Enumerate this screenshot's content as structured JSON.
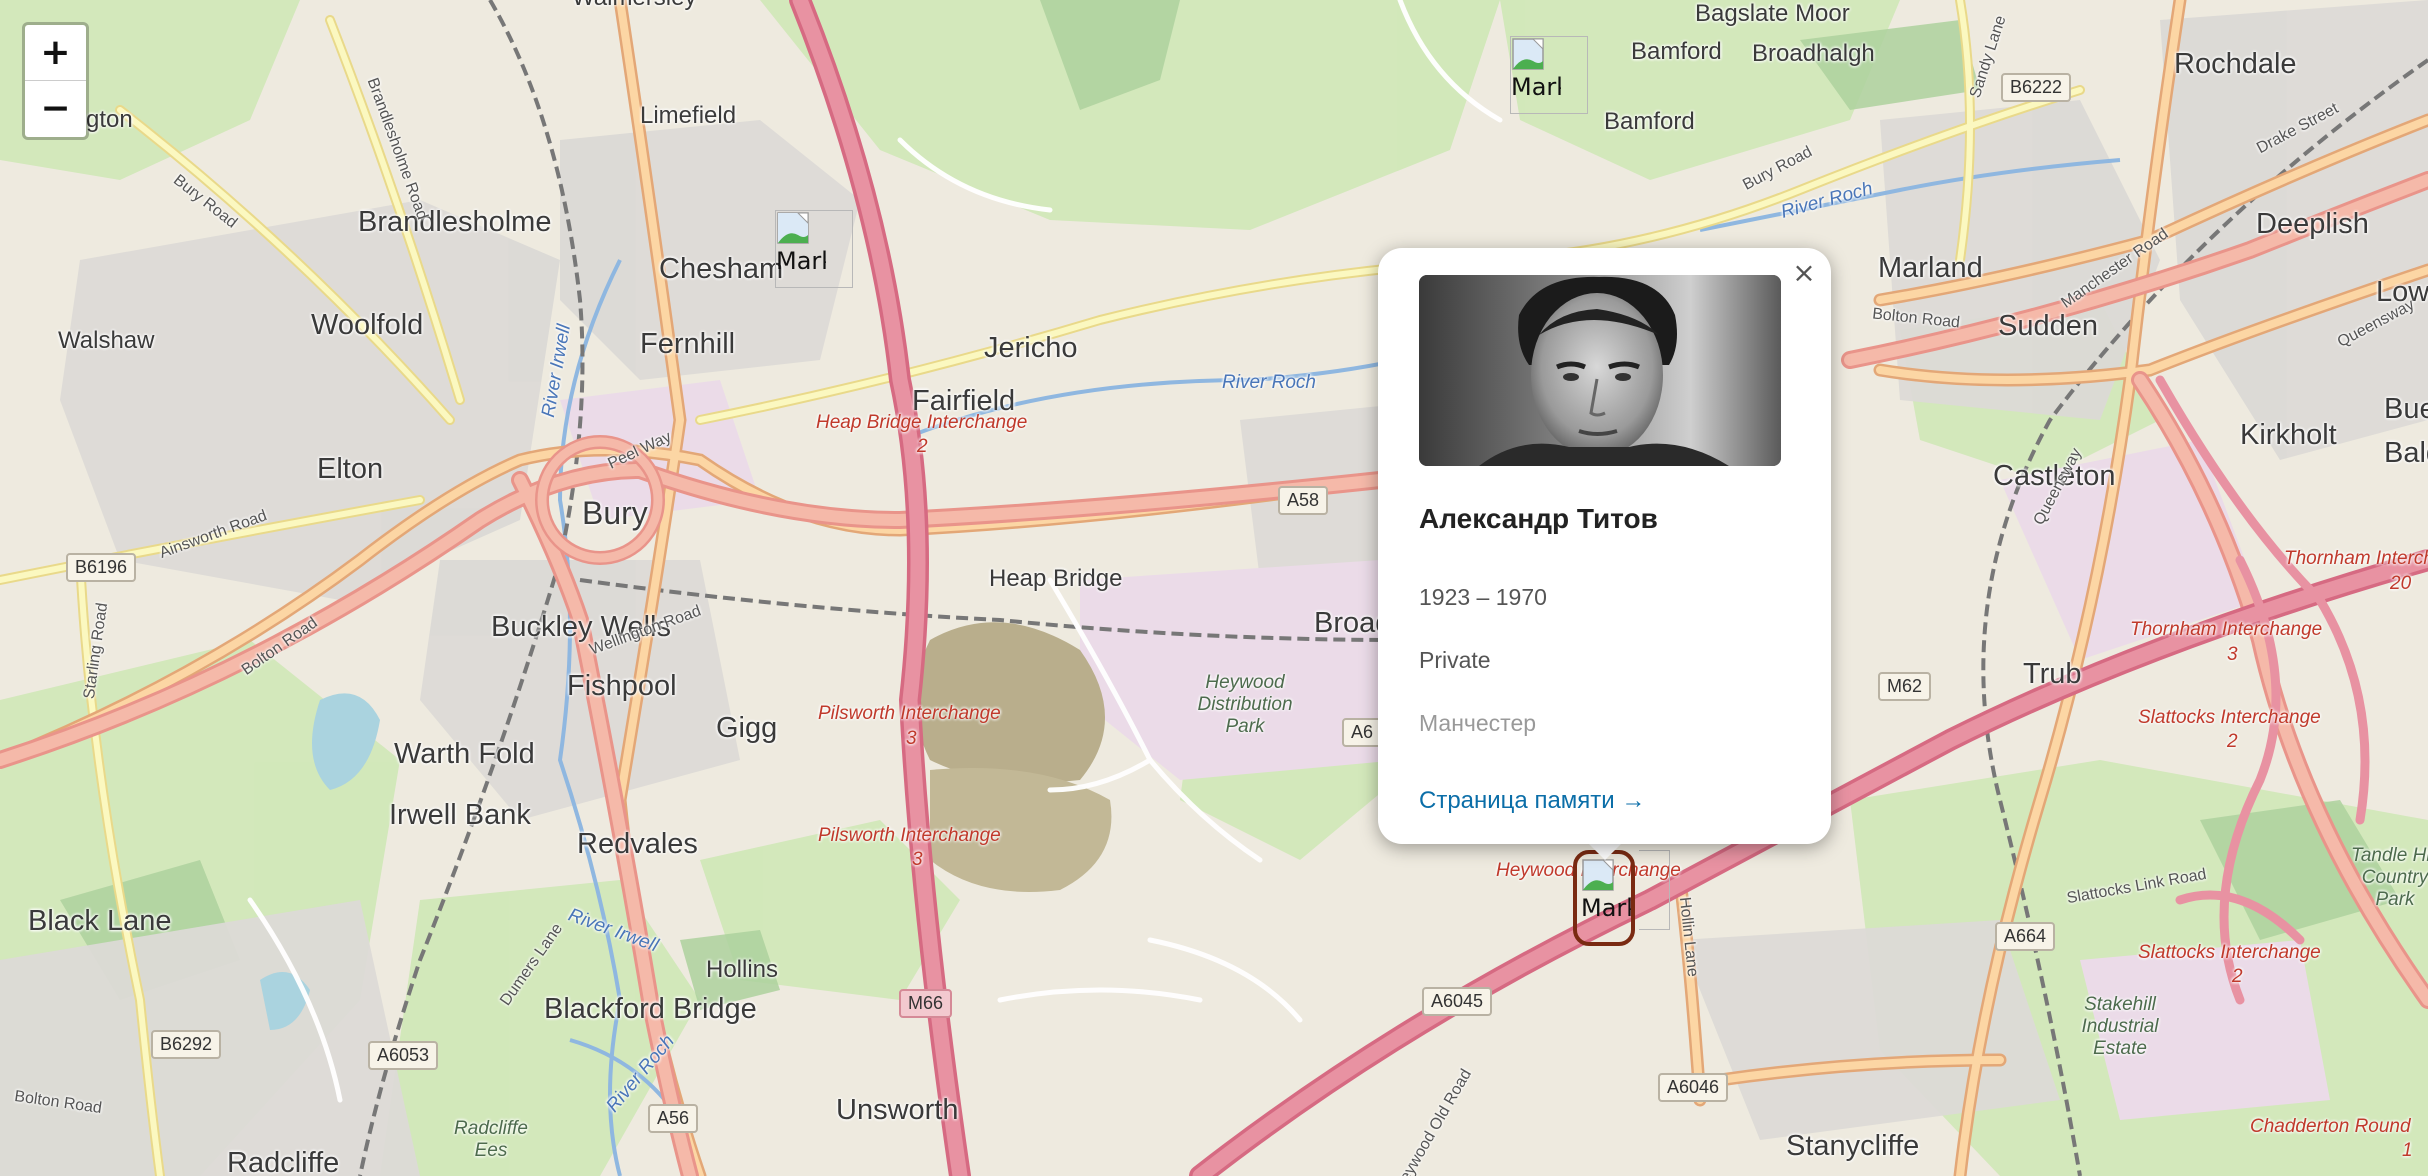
{
  "map": {
    "places": [
      {
        "id": "bagslate-moor",
        "name": "Bagslate Moor"
      },
      {
        "id": "bamford-1",
        "name": "Bamford"
      },
      {
        "id": "broadhalgh",
        "name": "Broadhalgh"
      },
      {
        "id": "bamford-2",
        "name": "Bamford"
      },
      {
        "id": "rochdale",
        "name": "Rochdale"
      },
      {
        "id": "limefield",
        "name": "Limefield"
      },
      {
        "id": "brandlesholme",
        "name": "Brandlesholme"
      },
      {
        "id": "chesham",
        "name": "Chesham"
      },
      {
        "id": "walshaw",
        "name": "Walshaw"
      },
      {
        "id": "woolfold",
        "name": "Woolfold"
      },
      {
        "id": "fernhill",
        "name": "Fernhill"
      },
      {
        "id": "jericho",
        "name": "Jericho"
      },
      {
        "id": "fairfield",
        "name": "Fairfield"
      },
      {
        "id": "marland",
        "name": "Marland"
      },
      {
        "id": "sudden",
        "name": "Sudden"
      },
      {
        "id": "deeplish",
        "name": "Deeplish"
      },
      {
        "id": "lower",
        "name": "Lower"
      },
      {
        "id": "elton",
        "name": "Elton"
      },
      {
        "id": "bury",
        "name": "Bury"
      },
      {
        "id": "heap-bridge",
        "name": "Heap Bridge"
      },
      {
        "id": "broad",
        "name": "Broad"
      },
      {
        "id": "kirkholt",
        "name": "Kirkholt"
      },
      {
        "id": "bue",
        "name": "Bue"
      },
      {
        "id": "balde",
        "name": "Balde"
      },
      {
        "id": "castleton",
        "name": "Castleton"
      },
      {
        "id": "buckley-wells",
        "name": "Buckley Wells"
      },
      {
        "id": "fishpool",
        "name": "Fishpool"
      },
      {
        "id": "gigg",
        "name": "Gigg"
      },
      {
        "id": "trub",
        "name": "Trub"
      },
      {
        "id": "warth-fold",
        "name": "Warth Fold"
      },
      {
        "id": "irwell-bank",
        "name": "Irwell Bank"
      },
      {
        "id": "redvales",
        "name": "Redvales"
      },
      {
        "id": "black-lane",
        "name": "Black Lane"
      },
      {
        "id": "hollins",
        "name": "Hollins"
      },
      {
        "id": "blackford-bridge",
        "name": "Blackford Bridge"
      },
      {
        "id": "unsworth",
        "name": "Unsworth"
      },
      {
        "id": "radcliffe",
        "name": "Radcliffe"
      },
      {
        "id": "stanycliffe",
        "name": "Stanycliffe"
      },
      {
        "id": "gton",
        "name": "gton"
      }
    ],
    "roads": [
      {
        "id": "bury-road-nw",
        "name": "Bury Road"
      },
      {
        "id": "brandlesholme-road",
        "name": "Brandlesholme Road"
      },
      {
        "id": "peel-way",
        "name": "Peel Way"
      },
      {
        "id": "ainsworth-road",
        "name": "Ainsworth Road"
      },
      {
        "id": "bolton-road-w",
        "name": "Bolton Road"
      },
      {
        "id": "starling-road",
        "name": "Starling Road"
      },
      {
        "id": "wellington-road",
        "name": "Wellington Road"
      },
      {
        "id": "bury-road-ne",
        "name": "Bury Road"
      },
      {
        "id": "sandy-lane",
        "name": "Sandy Lane"
      },
      {
        "id": "drake-street",
        "name": "Drake Street"
      },
      {
        "id": "manchester-road",
        "name": "Manchester Road"
      },
      {
        "id": "queensway-1",
        "name": "Queensway"
      },
      {
        "id": "queensway-2",
        "name": "Queensway"
      },
      {
        "id": "bolton-road-e",
        "name": "Bolton Road"
      },
      {
        "id": "slattocks-link",
        "name": "Slattocks Link Road"
      },
      {
        "id": "hollin-lane",
        "name": "Hollin Lane"
      },
      {
        "id": "dumers-lane",
        "name": "Dumers Lane"
      },
      {
        "id": "bolton-road-sw",
        "name": "Bolton Road"
      },
      {
        "id": "heywood-old-road",
        "name": "Heywood Old Road"
      }
    ],
    "water": [
      {
        "id": "river-roch-1",
        "name": "River Roch"
      },
      {
        "id": "river-roch-2",
        "name": "River Roch"
      },
      {
        "id": "river-irwell-1",
        "name": "River Irwell"
      },
      {
        "id": "river-irwell-2",
        "name": "River Irwell"
      },
      {
        "id": "river-roch-3",
        "name": "River Roch"
      }
    ],
    "junctions": [
      {
        "id": "heap-bridge-ic",
        "name": "Heap Bridge Interchange",
        "num": "2"
      },
      {
        "id": "pilsworth-ic-1",
        "name": "Pilsworth Interchange",
        "num": "3"
      },
      {
        "id": "pilsworth-ic-2",
        "name": "Pilsworth Interchange",
        "num": "3"
      },
      {
        "id": "heywood-ic",
        "name": "Heywood Interchange",
        "num": ""
      },
      {
        "id": "thornham-ic-1",
        "name": "Thornham Interchange",
        "num": "20"
      },
      {
        "id": "thornham-ic-2",
        "name": "Thornham Interchange",
        "num": "3"
      },
      {
        "id": "slattocks-ic-1",
        "name": "Slattocks Interchange",
        "num": "2"
      },
      {
        "id": "slattocks-ic-2",
        "name": "Slattocks Interchange",
        "num": "2"
      },
      {
        "id": "chadderton-ic",
        "name": "Chadderton Round",
        "num": "1"
      }
    ],
    "parks": [
      {
        "id": "heywood-dp",
        "name": "Heywood Distribution Park"
      },
      {
        "id": "tandle-hill",
        "name": "Tandle Hill Country Park"
      },
      {
        "id": "stakehill",
        "name": "Stakehill Industrial Estate"
      },
      {
        "id": "radcliffe-ees",
        "name": "Radcliffe Ees"
      }
    ],
    "shields": [
      {
        "id": "b6222",
        "label": "B6222",
        "type": "b"
      },
      {
        "id": "a58",
        "label": "A58",
        "type": "a"
      },
      {
        "id": "b6196",
        "label": "B6196",
        "type": "b"
      },
      {
        "id": "a6-partial",
        "label": "A6",
        "type": "a"
      },
      {
        "id": "m62",
        "label": "M62",
        "type": "a"
      },
      {
        "id": "a664",
        "label": "A664",
        "type": "a"
      },
      {
        "id": "a6045",
        "label": "A6045",
        "type": "a"
      },
      {
        "id": "a6046",
        "label": "A6046",
        "type": "a"
      },
      {
        "id": "m66",
        "label": "M66",
        "type": "motorway"
      },
      {
        "id": "a6053",
        "label": "A6053",
        "type": "a"
      },
      {
        "id": "b6292",
        "label": "B6292",
        "type": "b"
      },
      {
        "id": "a56",
        "label": "A56",
        "type": "a"
      }
    ],
    "top_partial": "Walmersley"
  },
  "zoom": {
    "in_label": "+",
    "out_label": "−"
  },
  "markers": {
    "alt_text": "Mark",
    "count": 3
  },
  "popup": {
    "close_label": "×",
    "name": "Александр Титов",
    "years": "1923 – 1970",
    "rank": "Private",
    "city": "Манчестер",
    "link_label": "Страница памяти →"
  },
  "colors": {
    "motorway": "#e892a2",
    "primary": "#fcd6a4",
    "secondary": "#f7fabf",
    "link": "#0b6ea8",
    "marker_active_border": "#7a2a12"
  }
}
